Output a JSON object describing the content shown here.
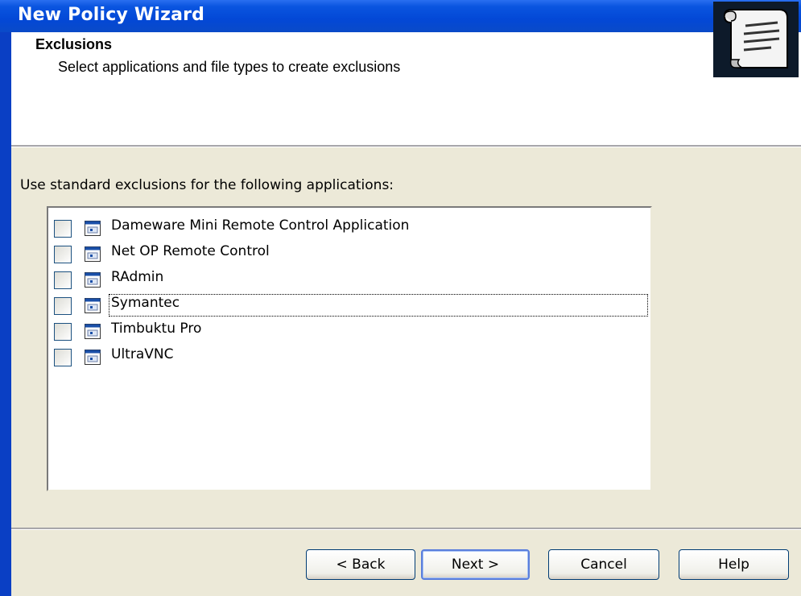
{
  "window": {
    "title": "New Policy Wizard"
  },
  "header": {
    "title": "Exclusions",
    "subtitle": "Select applications and file types to create exclusions",
    "icon": "scroll-document-icon"
  },
  "instructions": "Use standard exclusions for the following applications:",
  "applications": [
    {
      "label": "Dameware Mini Remote Control Application",
      "checked": false
    },
    {
      "label": "Net OP Remote Control",
      "checked": false
    },
    {
      "label": "RAdmin",
      "checked": false
    },
    {
      "label": "Symantec",
      "checked": false,
      "focused": true
    },
    {
      "label": "Timbuktu Pro",
      "checked": false
    },
    {
      "label": "UltraVNC",
      "checked": false
    }
  ],
  "buttons": {
    "back": "< Back",
    "next": "Next >",
    "cancel": "Cancel",
    "help": "Help"
  },
  "colors": {
    "titlebar": "#0348d6",
    "dialog_bg": "#ece9d8",
    "close": "#c6411a"
  }
}
